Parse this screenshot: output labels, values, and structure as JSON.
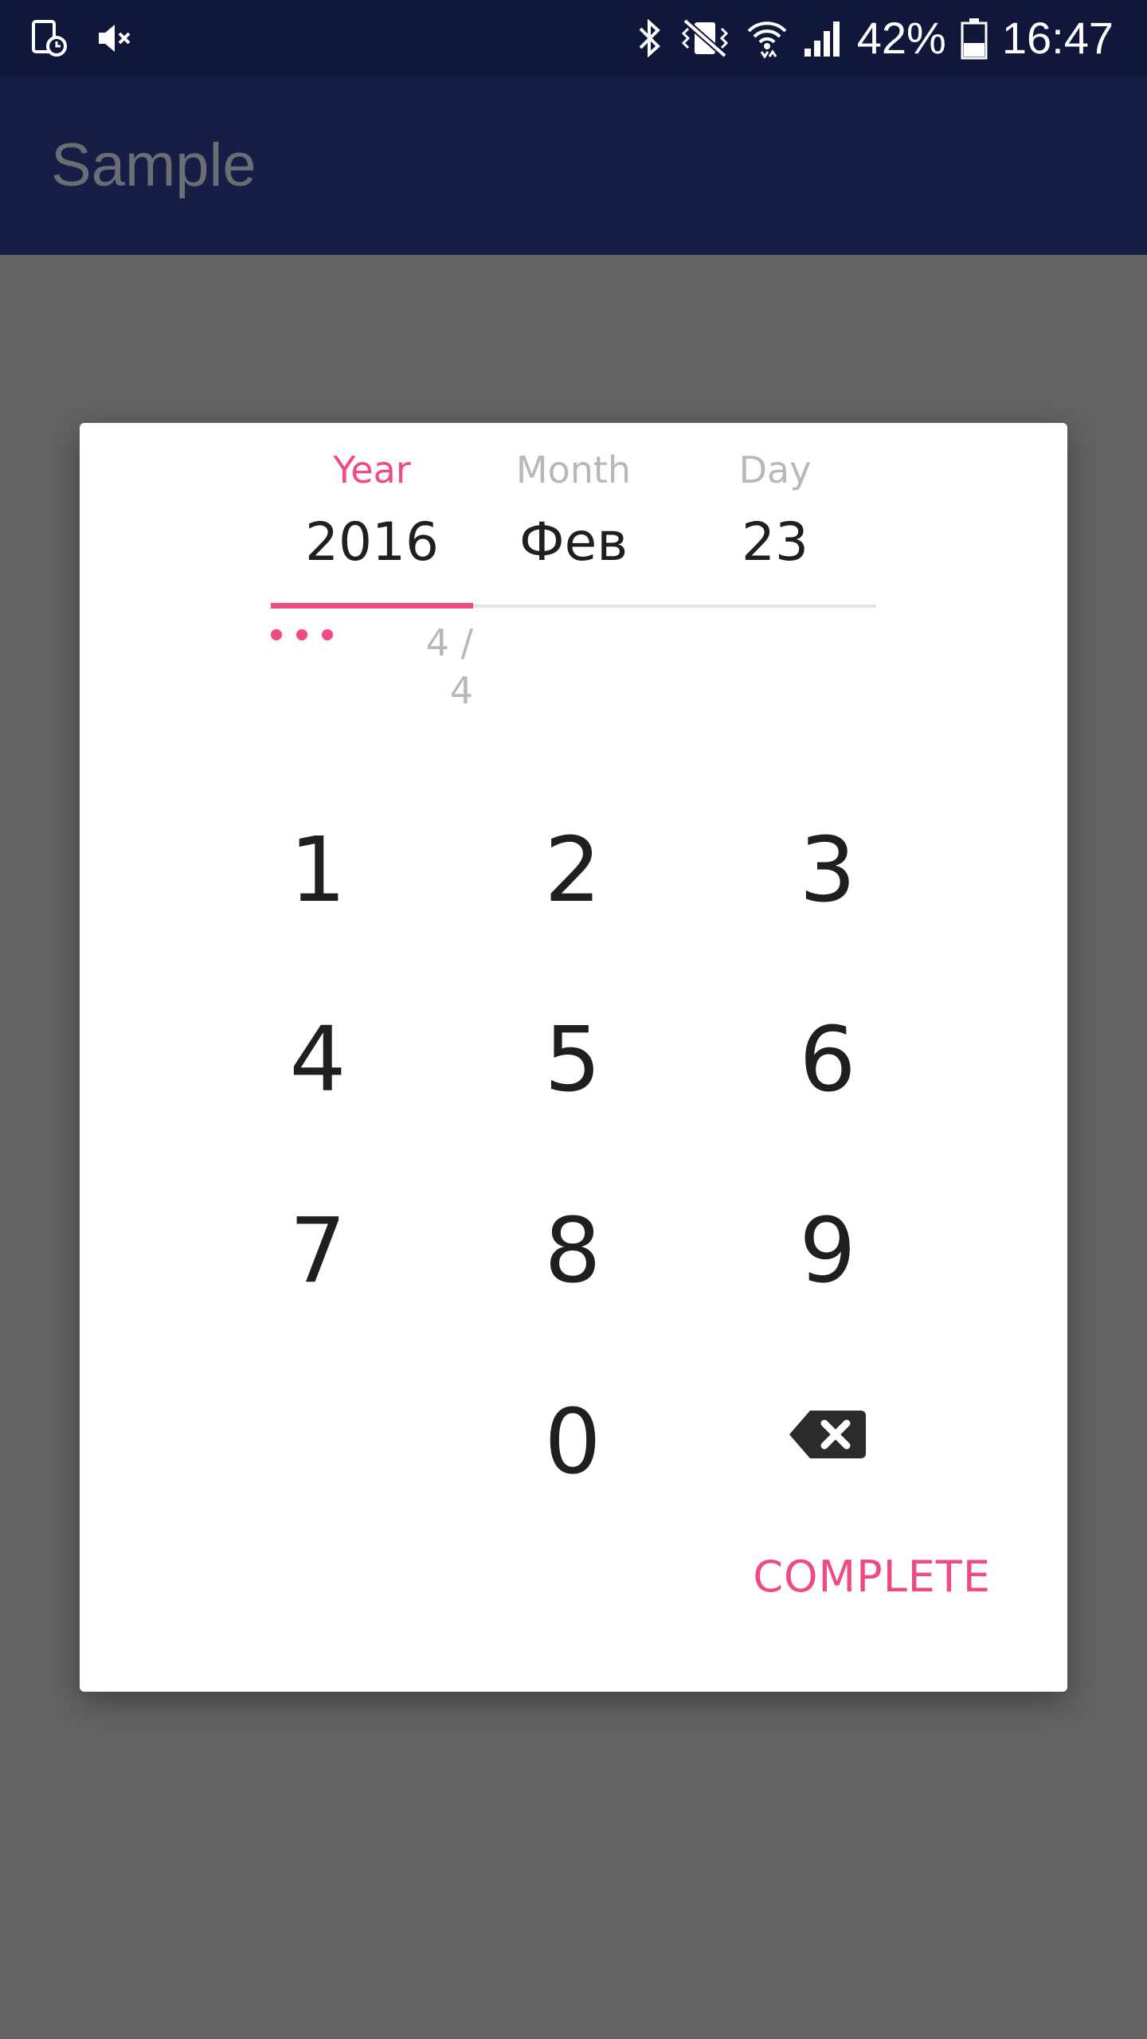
{
  "status_bar": {
    "battery_percent": "42%",
    "battery_level": 0.42,
    "time": "16:47",
    "left_icons": [
      "tablet-clock-icon",
      "volume-mute-icon"
    ],
    "right_icons": [
      "bluetooth-icon",
      "vibrate-icon",
      "wifi-icon",
      "signal-icon",
      "battery-icon"
    ]
  },
  "app_bar": {
    "title": "Sample"
  },
  "picker": {
    "tabs": [
      {
        "label": "Year",
        "value": "2016",
        "active": true
      },
      {
        "label": "Month",
        "value": "Фев",
        "active": false
      },
      {
        "label": "Day",
        "value": "23",
        "active": false
      }
    ],
    "digit_count": "4 / 4",
    "entered_digits": 3,
    "keypad": [
      "1",
      "2",
      "3",
      "4",
      "5",
      "6",
      "7",
      "8",
      "9",
      "0"
    ],
    "backspace_icon": "backspace-icon",
    "complete_label": "COMPLETE"
  },
  "colors": {
    "accent": "#ef4a84",
    "status_bar": "#11173a",
    "app_bar": "#181d45",
    "scrim_background": "#636363",
    "dialog": "#ffffff"
  }
}
